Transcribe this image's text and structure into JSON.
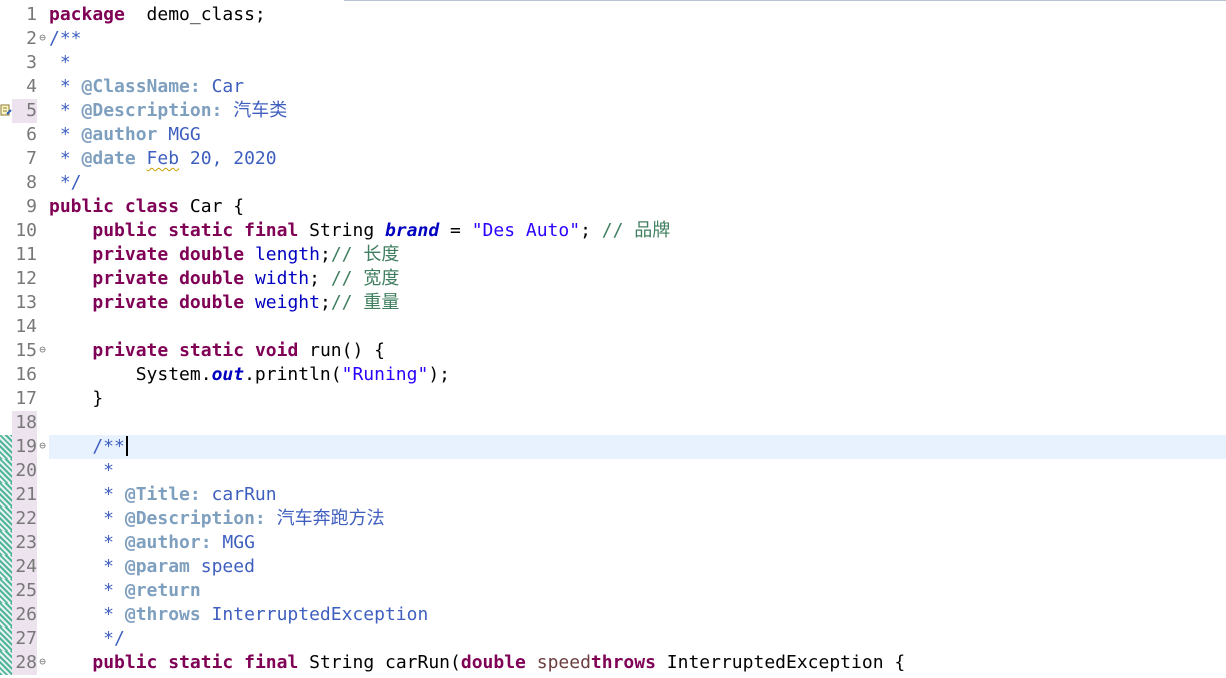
{
  "lines": [
    {
      "n": "1",
      "tokens": [
        [
          "kw",
          "package"
        ],
        [
          "",
          "  demo_class;"
        ]
      ]
    },
    {
      "n": "2",
      "fold": "⊖",
      "tokens": [
        [
          "cm",
          "/**"
        ]
      ]
    },
    {
      "n": "3",
      "tokens": [
        [
          "cm",
          " *"
        ]
      ]
    },
    {
      "n": "4",
      "tokens": [
        [
          "cm",
          " * "
        ],
        [
          "tag",
          "@ClassName:"
        ],
        [
          "cm",
          " Car"
        ]
      ]
    },
    {
      "n": "5",
      "marker": true,
      "highlight": true,
      "tokens": [
        [
          "cm",
          " * "
        ],
        [
          "tag",
          "@Description:"
        ],
        [
          "cm",
          " 汽车类"
        ]
      ]
    },
    {
      "n": "6",
      "tokens": [
        [
          "cm",
          " * "
        ],
        [
          "tag",
          "@author"
        ],
        [
          "cm",
          " MGG"
        ]
      ]
    },
    {
      "n": "7",
      "tokens": [
        [
          "cm",
          " * "
        ],
        [
          "tag",
          "@date"
        ],
        [
          "cm",
          " "
        ],
        [
          "cm squig",
          "Feb"
        ],
        [
          "cm",
          " 20, 2020"
        ]
      ]
    },
    {
      "n": "8",
      "tokens": [
        [
          "cm",
          " */"
        ]
      ]
    },
    {
      "n": "9",
      "tokens": [
        [
          "kw",
          "public"
        ],
        [
          "",
          " "
        ],
        [
          "kw",
          "class"
        ],
        [
          "",
          " Car {"
        ]
      ]
    },
    {
      "n": "10",
      "tokens": [
        [
          "",
          "    "
        ],
        [
          "kw",
          "public"
        ],
        [
          "",
          " "
        ],
        [
          "kw",
          "static"
        ],
        [
          "",
          " "
        ],
        [
          "kw",
          "final"
        ],
        [
          "",
          " String "
        ],
        [
          "sf",
          "brand"
        ],
        [
          "",
          " = "
        ],
        [
          "str",
          "\"Des Auto\""
        ],
        [
          "",
          "; "
        ],
        [
          "lc",
          "// 品牌"
        ]
      ]
    },
    {
      "n": "11",
      "tokens": [
        [
          "",
          "    "
        ],
        [
          "kw",
          "private"
        ],
        [
          "",
          " "
        ],
        [
          "kw",
          "double"
        ],
        [
          "",
          " "
        ],
        [
          "fld",
          "length"
        ],
        [
          "",
          ";"
        ],
        [
          "lc",
          "// 长度"
        ]
      ]
    },
    {
      "n": "12",
      "tokens": [
        [
          "",
          "    "
        ],
        [
          "kw",
          "private"
        ],
        [
          "",
          " "
        ],
        [
          "kw",
          "double"
        ],
        [
          "",
          " "
        ],
        [
          "fld",
          "width"
        ],
        [
          "",
          "; "
        ],
        [
          "lc",
          "// 宽度"
        ]
      ]
    },
    {
      "n": "13",
      "tokens": [
        [
          "",
          "    "
        ],
        [
          "kw",
          "private"
        ],
        [
          "",
          " "
        ],
        [
          "kw",
          "double"
        ],
        [
          "",
          " "
        ],
        [
          "fld",
          "weight"
        ],
        [
          "",
          ";"
        ],
        [
          "lc",
          "// 重量"
        ]
      ]
    },
    {
      "n": "14",
      "tokens": []
    },
    {
      "n": "15",
      "fold": "⊖",
      "tokens": [
        [
          "",
          "    "
        ],
        [
          "kw",
          "private"
        ],
        [
          "",
          " "
        ],
        [
          "kw",
          "static"
        ],
        [
          "",
          " "
        ],
        [
          "kw",
          "void"
        ],
        [
          "",
          " run() {"
        ]
      ]
    },
    {
      "n": "16",
      "tokens": [
        [
          "",
          "        System."
        ],
        [
          "sf",
          "out"
        ],
        [
          "",
          ".println("
        ],
        [
          "str",
          "\"Runing\""
        ],
        [
          "",
          ");"
        ]
      ]
    },
    {
      "n": "17",
      "tokens": [
        [
          "",
          "    }"
        ]
      ]
    },
    {
      "n": "18",
      "highlight": true,
      "tokens": []
    },
    {
      "n": "19",
      "fold": "⊖",
      "current": true,
      "diff": true,
      "highlight": true,
      "tokens": [
        [
          "cm",
          "    /**"
        ]
      ]
    },
    {
      "n": "20",
      "diff": true,
      "highlight": true,
      "tokens": [
        [
          "cm",
          "     *"
        ]
      ]
    },
    {
      "n": "21",
      "diff": true,
      "highlight": true,
      "tokens": [
        [
          "cm",
          "     * "
        ],
        [
          "tag",
          "@Title:"
        ],
        [
          "cm",
          " carRun"
        ]
      ]
    },
    {
      "n": "22",
      "diff": true,
      "highlight": true,
      "tokens": [
        [
          "cm",
          "     * "
        ],
        [
          "tag",
          "@Description:"
        ],
        [
          "cm",
          " 汽车奔跑方法"
        ]
      ]
    },
    {
      "n": "23",
      "diff": true,
      "highlight": true,
      "tokens": [
        [
          "cm",
          "     * "
        ],
        [
          "tag",
          "@author:"
        ],
        [
          "cm",
          " MGG"
        ]
      ]
    },
    {
      "n": "24",
      "diff": true,
      "highlight": true,
      "tokens": [
        [
          "cm",
          "     * "
        ],
        [
          "tag",
          "@param"
        ],
        [
          "cm",
          " speed"
        ]
      ]
    },
    {
      "n": "25",
      "diff": true,
      "highlight": true,
      "tokens": [
        [
          "cm",
          "     * "
        ],
        [
          "tag",
          "@return"
        ]
      ]
    },
    {
      "n": "26",
      "diff": true,
      "highlight": true,
      "tokens": [
        [
          "cm",
          "     * "
        ],
        [
          "tag",
          "@throws"
        ],
        [
          "cm",
          " InterruptedException"
        ]
      ]
    },
    {
      "n": "27",
      "diff": true,
      "highlight": true,
      "tokens": [
        [
          "cm",
          "     */"
        ]
      ]
    },
    {
      "n": "28",
      "fold": "⊖",
      "diff": true,
      "highlight": true,
      "tokens": [
        [
          "",
          "    "
        ],
        [
          "kw",
          "public"
        ],
        [
          "",
          " "
        ],
        [
          "kw",
          "static"
        ],
        [
          "",
          " "
        ],
        [
          "kw",
          "final"
        ],
        [
          "",
          " String carRun("
        ],
        [
          "kw",
          "double"
        ],
        [
          "",
          " "
        ],
        [
          "param",
          "speed"
        ],
        [
          ") "
        ],
        [
          "kw",
          "throws"
        ],
        [
          "",
          " InterruptedException {"
        ]
      ]
    }
  ]
}
